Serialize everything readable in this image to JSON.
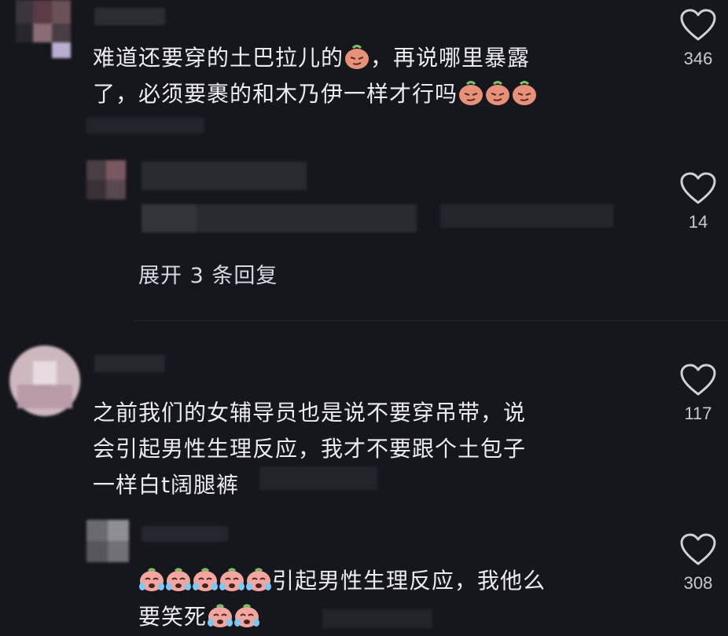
{
  "comments": [
    {
      "avatar_style": "pixelated",
      "text_line1": "难道还要穿的土巴拉儿的",
      "text_line1b": "，再说哪里暴露",
      "text_line2": "了，必须要裹的和木乃伊一样才行吗",
      "likes": "346",
      "reply": {
        "likes": "14"
      },
      "expand_label": "展开 3 条回复"
    },
    {
      "avatar_style": "pixelated",
      "text_line1": "之前我们的女辅导员也是说不要穿吊带，说",
      "text_line2": "会引起男性生理反应，我才不要跟个土包子",
      "text_line3": "一样白t阔腿裤",
      "likes": "117",
      "reply": {
        "text_line1": "引起男性生理反应，我他么",
        "text_line2": "要笑死",
        "likes": "308"
      }
    }
  ],
  "icons": {
    "like": "heart-outline-icon",
    "emoji_smirk": "smirk-sticker-icon",
    "emoji_cry": "crying-laugh-sticker-icon"
  },
  "colors": {
    "background": "#16161d",
    "text": "#ececf0",
    "muted": "#c9c9d1"
  }
}
